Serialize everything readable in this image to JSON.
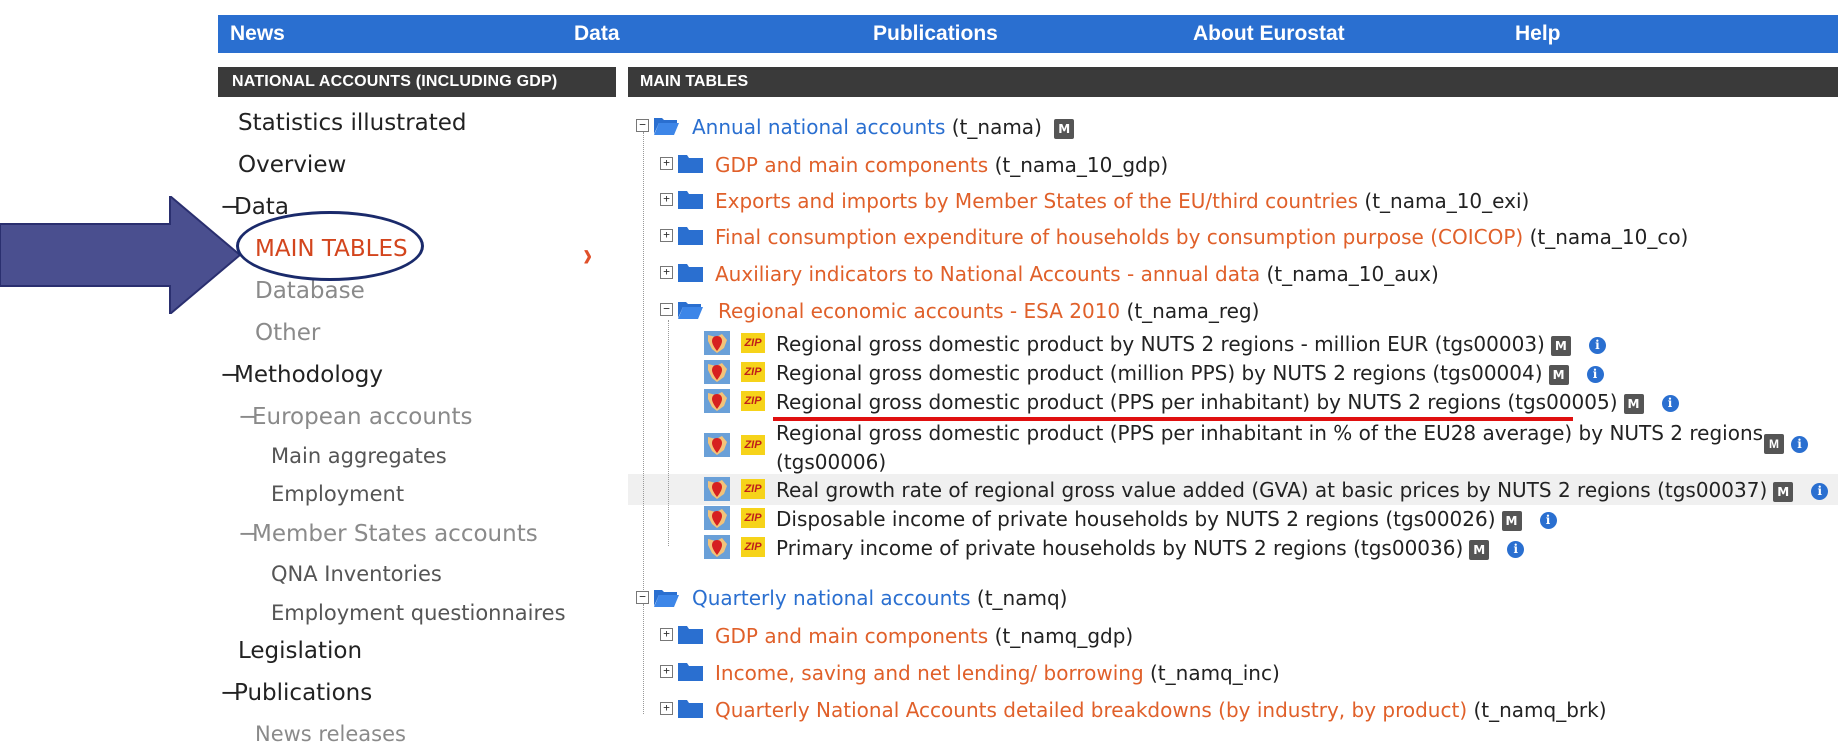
{
  "topnav": {
    "items": [
      "News",
      "Data",
      "Publications",
      "About Eurostat",
      "Help"
    ]
  },
  "sidebar": {
    "header": "NATIONAL ACCOUNTS (INCLUDING GDP)",
    "items": [
      {
        "label": "Statistics illustrated"
      },
      {
        "label": "Overview"
      },
      {
        "label": "Data"
      },
      {
        "label": "MAIN TABLES"
      },
      {
        "label": "Database"
      },
      {
        "label": "Other"
      },
      {
        "label": "Methodology"
      },
      {
        "label": "European accounts"
      },
      {
        "label": "Main aggregates"
      },
      {
        "label": "Employment"
      },
      {
        "label": "Member States accounts"
      },
      {
        "label": "QNA Inventories"
      },
      {
        "label": "Employment questionnaires"
      },
      {
        "label": "Legislation"
      },
      {
        "label": "Publications"
      },
      {
        "label": "News releases"
      }
    ]
  },
  "main": {
    "header": "MAIN TABLES",
    "tree": {
      "annual": {
        "label": "Annual national accounts",
        "code": "(t_nama)"
      },
      "annual_children": [
        {
          "label": "GDP and main components",
          "code": "(t_nama_10_gdp)"
        },
        {
          "label": "Exports and imports by Member States of the EU/third countries",
          "code": "(t_nama_10_exi)"
        },
        {
          "label": "Final consumption expenditure of households by consumption purpose (COICOP)",
          "code": "(t_nama_10_co)"
        },
        {
          "label": "Auxiliary indicators to National Accounts - annual data",
          "code": "(t_nama_10_aux)"
        }
      ],
      "regional": {
        "label": "Regional economic accounts - ESA 2010",
        "code": "(t_nama_reg)"
      },
      "datasets": [
        {
          "text": "Regional gross domestic product by NUTS 2 regions - million EUR (tgs00003)"
        },
        {
          "text": "Regional gross domestic product (million PPS) by NUTS 2 regions (tgs00004)"
        },
        {
          "text": "Regional gross domestic product (PPS per inhabitant) by NUTS 2 regions (tgs00005)"
        },
        {
          "text": "Regional gross domestic product (PPS per inhabitant in % of the EU28 average) by NUTS 2 regions",
          "text2": "(tgs00006)"
        },
        {
          "text": "Real growth rate of regional gross value added (GVA) at basic prices by NUTS 2 regions (tgs00037)"
        },
        {
          "text": "Disposable income of private households by NUTS 2 regions (tgs00026)"
        },
        {
          "text": "Primary income of private households by NUTS 2 regions (tgs00036)"
        }
      ],
      "quarterly": {
        "label": "Quarterly national accounts",
        "code": "(t_namq)"
      },
      "quarterly_children": [
        {
          "label": "GDP and main components",
          "code": "(t_namq_gdp)"
        },
        {
          "label": "Income, saving and net lending/ borrowing",
          "code": "(t_namq_inc)"
        },
        {
          "label": "Quarterly National Accounts detailed breakdowns (by industry, by product)",
          "code": "(t_namq_brk)"
        }
      ],
      "m_badge": "M",
      "zip_badge": "ZIP",
      "info_badge": "i"
    }
  },
  "colors": {
    "nav_blue": "#2a6fd0",
    "header_dark": "#3a3a3a",
    "link_orange": "#e0602a",
    "active_red": "#d3451d",
    "arrow_blue": "#4a4f8f"
  }
}
